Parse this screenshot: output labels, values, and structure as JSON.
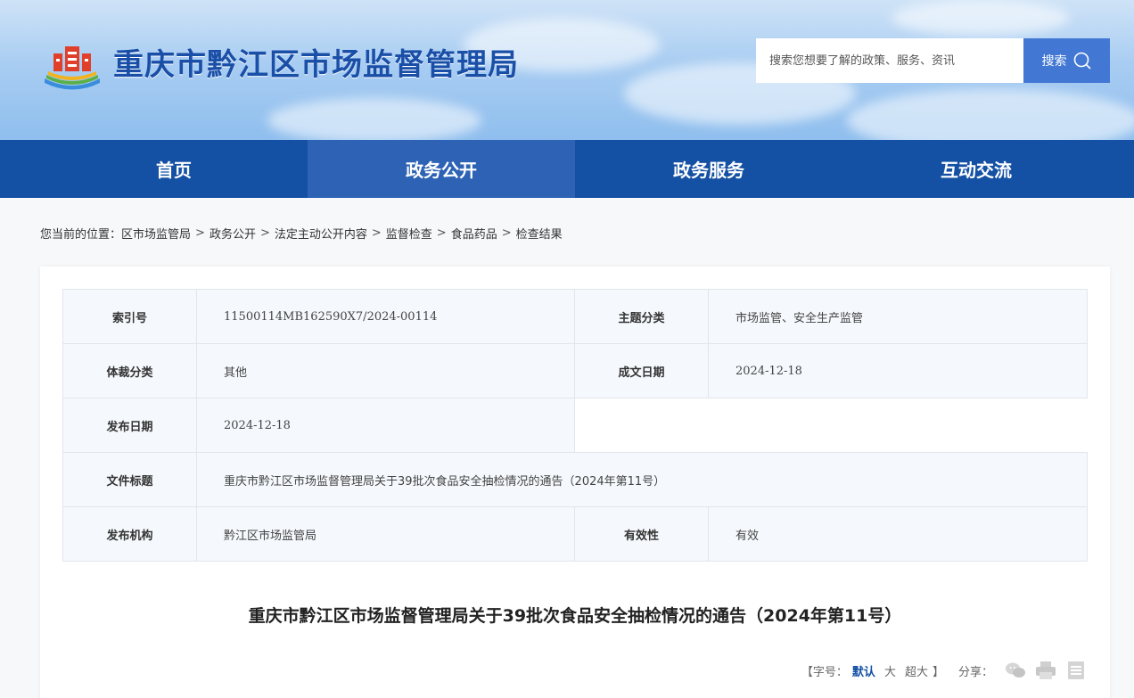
{
  "site": {
    "title": "重庆市黔江区市场监督管理局",
    "search_placeholder": "搜索您想要了解的政策、服务、资讯",
    "search_button": "搜索"
  },
  "nav": {
    "items": [
      {
        "label": "首页"
      },
      {
        "label": "政务公开"
      },
      {
        "label": "政务服务"
      },
      {
        "label": "互动交流"
      }
    ],
    "active_index": 1
  },
  "breadcrumb": {
    "prefix": "您当前的位置：",
    "items": [
      "区市场监管局",
      "政务公开",
      "法定主动公开内容",
      "监督检查",
      "食品药品",
      "检查结果"
    ],
    "separator": ">"
  },
  "meta": {
    "index_label": "索引号",
    "index_value": "11500114MB162590X7/2024-00114",
    "topic_label": "主题分类",
    "topic_value": "市场监管、安全生产监管",
    "genre_label": "体裁分类",
    "genre_value": "其他",
    "written_date_label": "成文日期",
    "written_date_value": "2024-12-18",
    "publish_date_label": "发布日期",
    "publish_date_value": "2024-12-18",
    "doc_title_label": "文件标题",
    "doc_title_value": "重庆市黔江区市场监督管理局关于39批次食品安全抽检情况的通告（2024年第11号）",
    "issuer_label": "发布机构",
    "issuer_value": "黔江区市场监管局",
    "validity_label": "有效性",
    "validity_value": "有效"
  },
  "article": {
    "title": "重庆市黔江区市场监督管理局关于39批次食品安全抽检情况的通告（2024年第11号）"
  },
  "tools": {
    "bracket_open": "【",
    "font_label": "字号：",
    "font_default": "默认",
    "font_large": "大",
    "font_xlarge": "超大",
    "bracket_close": "】",
    "share_label": "分享："
  },
  "colors": {
    "nav_bg": "#1450a4",
    "nav_active": "#2d62b4",
    "title_blue": "#1a4fa8",
    "search_btn": "#4278d4"
  }
}
